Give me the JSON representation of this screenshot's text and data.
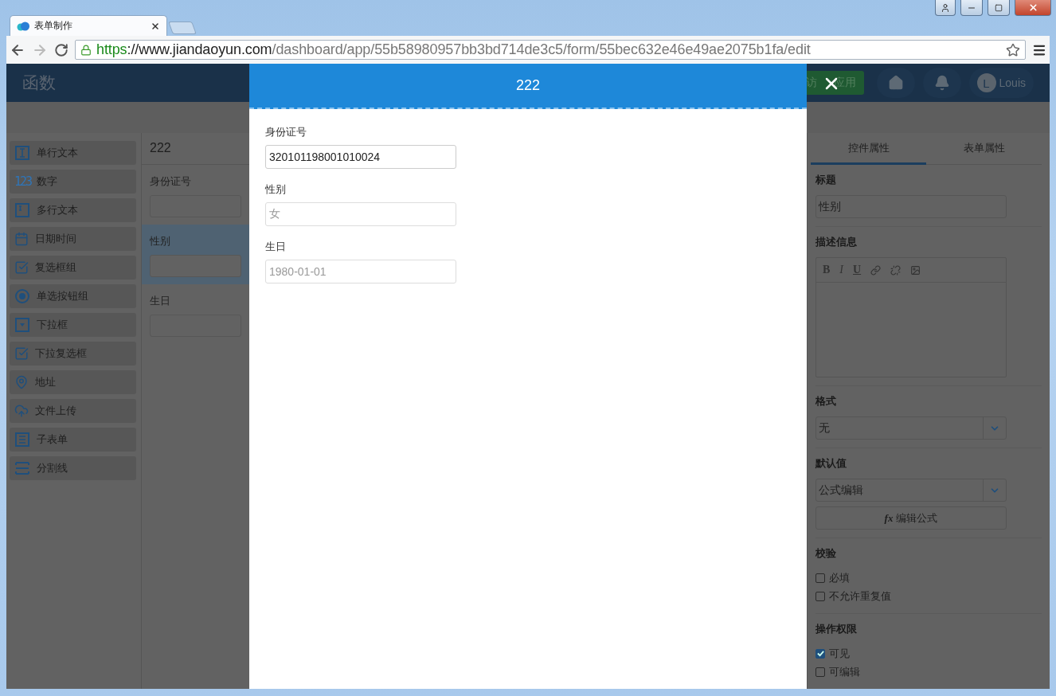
{
  "browser": {
    "tab_title": "表单制作",
    "url": {
      "scheme": "https",
      "host": "://www.jiandaoyun.com",
      "path": "/dashboard/app/55b58980957bb3bd714de3c5/form/55bec632e46e49ae2075b1fa/edit"
    }
  },
  "header": {
    "title": "函数",
    "visit_button": [
      "访",
      "应用"
    ],
    "user_initial": "L",
    "user_name": "Louis"
  },
  "sidebar": {
    "items": [
      {
        "kind": "text",
        "label": "单行文本"
      },
      {
        "kind": "number",
        "glyph": "123",
        "label": "数字"
      },
      {
        "kind": "textarea",
        "label": "多行文本"
      },
      {
        "kind": "datetime",
        "label": "日期时间"
      },
      {
        "kind": "checkbox",
        "label": "复选框组"
      },
      {
        "kind": "radio",
        "label": "单选按钮组"
      },
      {
        "kind": "select",
        "label": "下拉框"
      },
      {
        "kind": "multiselect",
        "label": "下拉复选框"
      },
      {
        "kind": "address",
        "label": "地址"
      },
      {
        "kind": "upload",
        "label": "文件上传"
      },
      {
        "kind": "subform",
        "label": "子表单"
      },
      {
        "kind": "divider",
        "label": "分割线"
      }
    ]
  },
  "canvas": {
    "title": "222",
    "fields": [
      {
        "label": "身份证号",
        "selected": false
      },
      {
        "label": "性别",
        "selected": true
      },
      {
        "label": "生日",
        "selected": false
      }
    ]
  },
  "modal": {
    "title": "222",
    "fields": [
      {
        "label": "身份证号",
        "value": "320101198001010024",
        "disabled": false
      },
      {
        "label": "性别",
        "value": "女",
        "disabled": true
      },
      {
        "label": "生日",
        "value": "1980-01-01",
        "disabled": true
      }
    ]
  },
  "properties": {
    "tabs": [
      {
        "label": "控件属性",
        "selected": true
      },
      {
        "label": "表单属性",
        "selected": false
      }
    ],
    "title_label": "标题",
    "title_value": "性别",
    "description_label": "描述信息",
    "editor_buttons": [
      {
        "kind": "bold",
        "glyph": "B"
      },
      {
        "kind": "italic",
        "glyph": "I"
      },
      {
        "kind": "underline",
        "glyph": "U"
      },
      {
        "kind": "link"
      },
      {
        "kind": "unlink"
      },
      {
        "kind": "image"
      }
    ],
    "format_label": "格式",
    "format_value": "无",
    "default_label": "默认值",
    "default_value": "公式编辑",
    "formula_button": {
      "icon_text": "fx",
      "label": "编辑公式"
    },
    "validation_label": "校验",
    "validation": [
      {
        "label": "必填",
        "checked": false
      },
      {
        "label": "不允许重复值",
        "checked": false
      }
    ],
    "permission_label": "操作权限",
    "permissions": [
      {
        "label": "可见",
        "checked": true
      },
      {
        "label": "可编辑",
        "checked": false
      }
    ]
  }
}
